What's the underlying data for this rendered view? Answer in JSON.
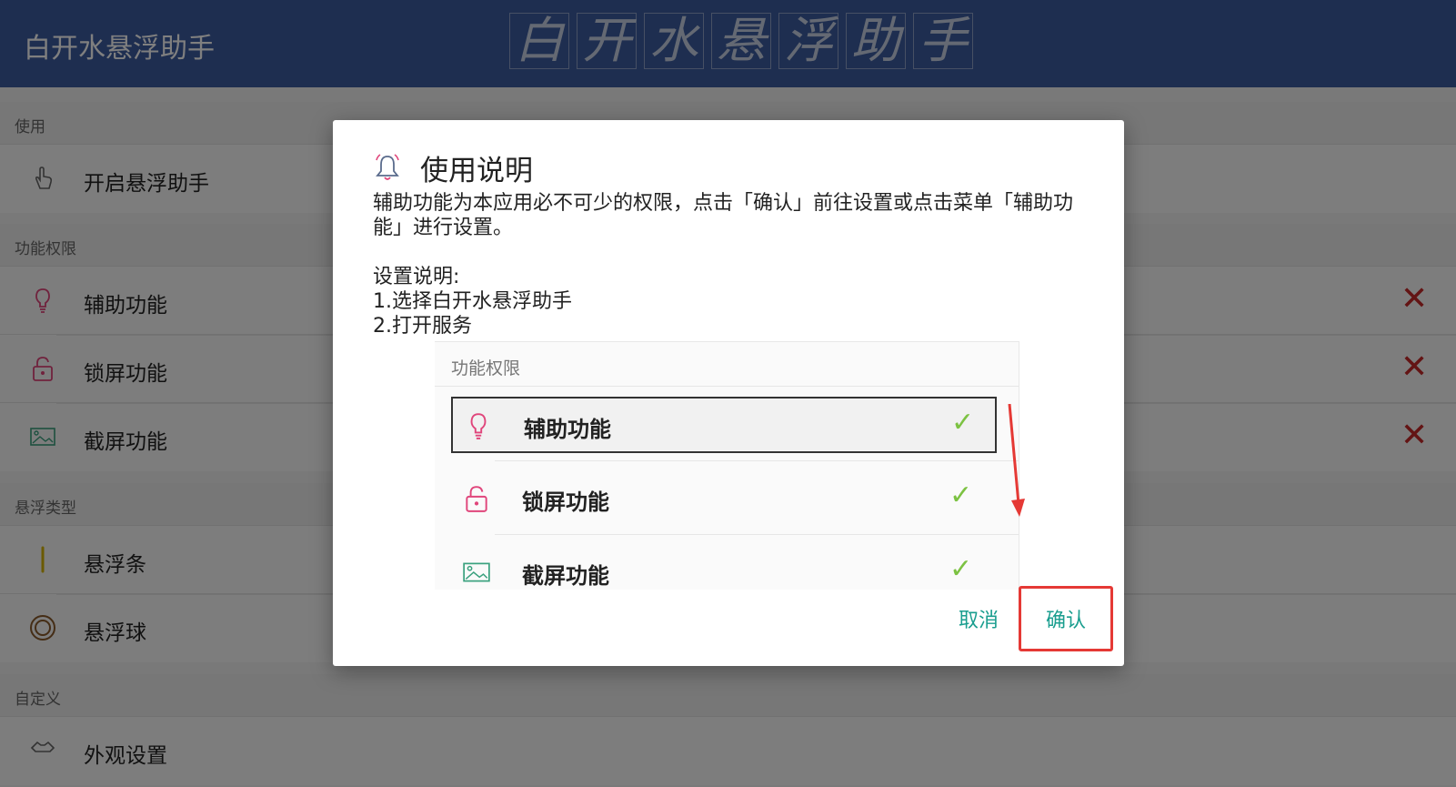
{
  "appbar": {
    "title": "白开水悬浮助手",
    "logo_chars": [
      "白",
      "开",
      "水",
      "悬",
      "浮",
      "助",
      "手"
    ],
    "bg_color": "#3d5ca0"
  },
  "sections": [
    {
      "header": "使用",
      "items": [
        {
          "label": "开启悬浮助手",
          "icon": "hand-pointer-icon"
        }
      ]
    },
    {
      "header": "功能权限",
      "items": [
        {
          "label": "辅助功能",
          "icon": "lightbulb-icon",
          "status": "✕"
        },
        {
          "label": "锁屏功能",
          "icon": "lock-icon",
          "status": "✕"
        },
        {
          "label": "截屏功能",
          "icon": "screenshot-icon",
          "status": "✕"
        }
      ]
    },
    {
      "header": "悬浮类型",
      "items": [
        {
          "label": "悬浮条",
          "icon": "float-bar-icon"
        },
        {
          "label": "悬浮球",
          "icon": "float-ball-icon"
        }
      ]
    },
    {
      "header": "自定义",
      "items": [
        {
          "label": "外观设置",
          "icon": "appearance-icon"
        }
      ]
    }
  ],
  "dialog": {
    "title": "使用说明",
    "icon": "bell-icon",
    "message": "辅助功能为本应用必不可少的权限，点击「确认」前往设置或点击菜单「辅助功能」进行设置。",
    "instructions_title": "设置说明:",
    "steps": [
      "1.选择白开水悬浮助手",
      "2.打开服务"
    ],
    "example": {
      "header": "功能权限",
      "items": [
        {
          "label": "辅助功能",
          "icon": "lightbulb-icon",
          "check": "✓"
        },
        {
          "label": "锁屏功能",
          "icon": "lock-icon",
          "check": "✓"
        },
        {
          "label": "截屏功能",
          "icon": "screenshot-icon",
          "check": "✓"
        }
      ]
    },
    "cancel_label": "取消",
    "confirm_label": "确认",
    "accent_color": "#1a9e8f",
    "highlight_color": "#e53935"
  }
}
